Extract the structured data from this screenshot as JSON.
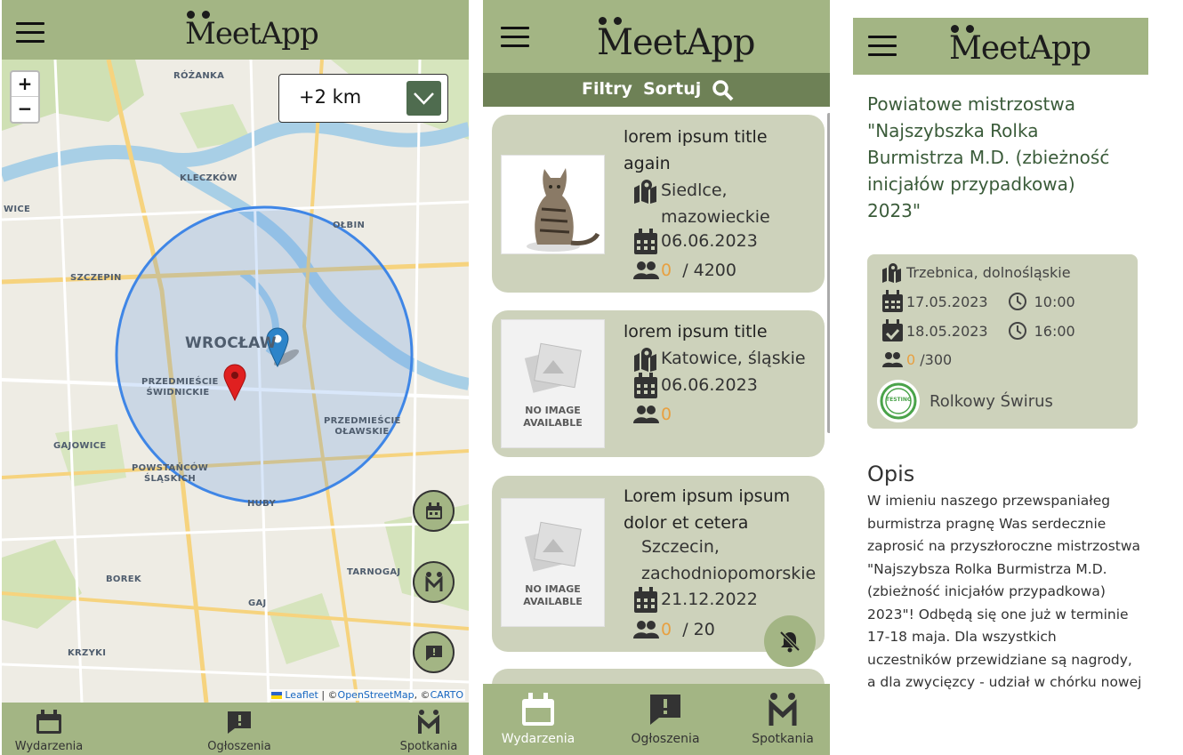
{
  "app": {
    "brand": "MeetApp"
  },
  "map_screen": {
    "zoom_in": "+",
    "zoom_out": "−",
    "distance_value": "+2 km",
    "labels": [
      "RÓŻANKA",
      "KLECZKÓW",
      "WICE",
      "OŁBIN",
      "SZCZEPIN",
      "WROCŁAW",
      "PRZEDMIEŚCIE ŚWIDNICKIE",
      "PRZEDMIEŚCIE OŁAWSKIE",
      "GAJOWICE",
      "POWSTAŃCÓW ŚLĄSKICH",
      "HUBY",
      "TARNOGAJ",
      "BOREK",
      "GAJ",
      "KRZYKI"
    ],
    "attribution": {
      "leaflet": "Leaflet",
      "sep1": " | ©",
      "osm": "OpenStreetMap",
      "sep2": ", ©",
      "carto": "CARTO"
    }
  },
  "nav": {
    "events": "Wydarzenia",
    "announcements": "Ogłoszenia",
    "meetings": "Spotkania"
  },
  "list_screen": {
    "filter": "Filtry",
    "sort": "Sortuj",
    "no_image": "NO IMAGE AVAILABLE",
    "cards": [
      {
        "title": "lorem ipsum title again",
        "location": "Siedlce, mazowieckie",
        "date": "06.06.2023",
        "count": "0",
        "limit": "/ 4200"
      },
      {
        "title": "lorem ipsum title",
        "location": "Katowice, śląskie",
        "date": "06.06.2023",
        "count": "0",
        "limit": ""
      },
      {
        "title": "Lorem ipsum ipsum dolor et cetera",
        "location": "Szczecin, zachodniopomorskie",
        "date": "21.12.2022",
        "count": "0",
        "limit": "/ 20"
      }
    ]
  },
  "detail_screen": {
    "title": "Powiatowe mistrzostwa \"Najszybszka Rolka Burmistrza M.D. (zbieżność inicjałów przypadkowa) 2023\"",
    "location": "Trzebnica, dolnośląskie",
    "start_date": "17.05.2023",
    "start_time": "10:00",
    "end_date": "18.05.2023",
    "end_time": "16:00",
    "count": "0",
    "limit": "/300",
    "organizer": "Rolkowy Świrus",
    "organizer_badge": "TESTING",
    "description_heading": "Opis",
    "description": "W imieniu naszego przewspaniałeg burmistrza pragnę Was serdecznie zaprosić na przyszłoroczne mistrzostwa \"Najszybsza Rolka Burmistrza M.D. (zbieżność inicjałów przypadkowa) 2023\"! Odbędą się one już w terminie 17-18 maja. Dla wszystkich uczestników przewidziane są nagrody, a dla zwycięzcy - udział w chórku nowej"
  },
  "colors": {
    "header": "#a3b584",
    "filterbar": "#6e8156",
    "card": "#cdd2bb",
    "accent_zero": "#e8a040",
    "title_green": "#3a5b39",
    "radius_circle": "#3f86e6"
  },
  "icons": [
    "menu-icon",
    "chevron-down-icon",
    "calendar-icon",
    "announcement-icon",
    "meetapp-icon",
    "map-location-icon",
    "people-icon",
    "search-icon",
    "bell-off-icon",
    "clock-icon",
    "calendar-check-icon"
  ]
}
